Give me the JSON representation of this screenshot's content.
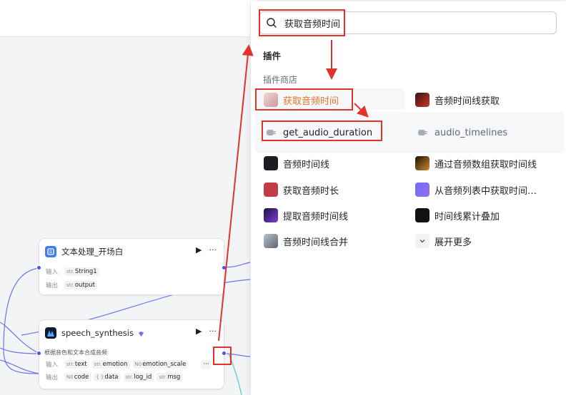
{
  "colors": {
    "accent": "#4d53e8",
    "highlight": "#e8742b",
    "annotation": "#e3322a",
    "edge_teal": "#5fd3c6"
  },
  "search": {
    "value": "获取音频时间",
    "icon": "search-icon"
  },
  "panel": {
    "section_title": "插件",
    "section_subtitle": "插件商店",
    "results": [
      {
        "label": "获取音频时间",
        "icon": "avatar-girl-thumb",
        "active": true
      },
      {
        "label": "音频时间线获取",
        "icon": "avatar-character-thumb",
        "active": false
      }
    ],
    "tools": [
      {
        "label": "get_audio_duration",
        "icon": "plugin-tool-icon"
      },
      {
        "label": "audio_timelines",
        "icon": "plugin-tool-icon"
      }
    ],
    "items": [
      {
        "label": "音频时间线",
        "icon": "waveform-thumb"
      },
      {
        "label": "通过音频数组获取时间线",
        "icon": "music-thumb"
      },
      {
        "label": "获取音频时长",
        "icon": "radio-thumb"
      },
      {
        "label": "从音频列表中获取时间…",
        "icon": "cube-thumb"
      },
      {
        "label": "提取音频时间线",
        "icon": "wave-purple-thumb"
      },
      {
        "label": "时间线累计叠加",
        "icon": "ai-logo-thumb"
      },
      {
        "label": "音频时间线合并",
        "icon": "person-thumb"
      },
      {
        "label": "展开更多",
        "icon": "chevron-down-icon"
      }
    ]
  },
  "nodes": {
    "text_process": {
      "title": "文本处理_开场白",
      "input_label": "输入",
      "input_tag_type": "str.",
      "input_tag": "String1",
      "output_label": "输出",
      "output_tag_type": "str.",
      "output_tag": "output"
    },
    "speech": {
      "title": "speech_synthesis",
      "description": "根据音色和文本合成音频",
      "input_label": "输入",
      "inputs": [
        {
          "type": "str.",
          "name": "text"
        },
        {
          "type": "str.",
          "name": "emotion"
        },
        {
          "type": "N0",
          "name": "emotion_scale"
        }
      ],
      "more": "···",
      "output_label": "输出",
      "outputs": [
        {
          "type": "N0",
          "name": "code"
        },
        {
          "type": "{ }",
          "name": "data"
        },
        {
          "type": "str.",
          "name": "log_id"
        },
        {
          "type": "str.",
          "name": "msg"
        }
      ]
    }
  },
  "node_actions": {
    "run": "▶",
    "more": "···"
  }
}
